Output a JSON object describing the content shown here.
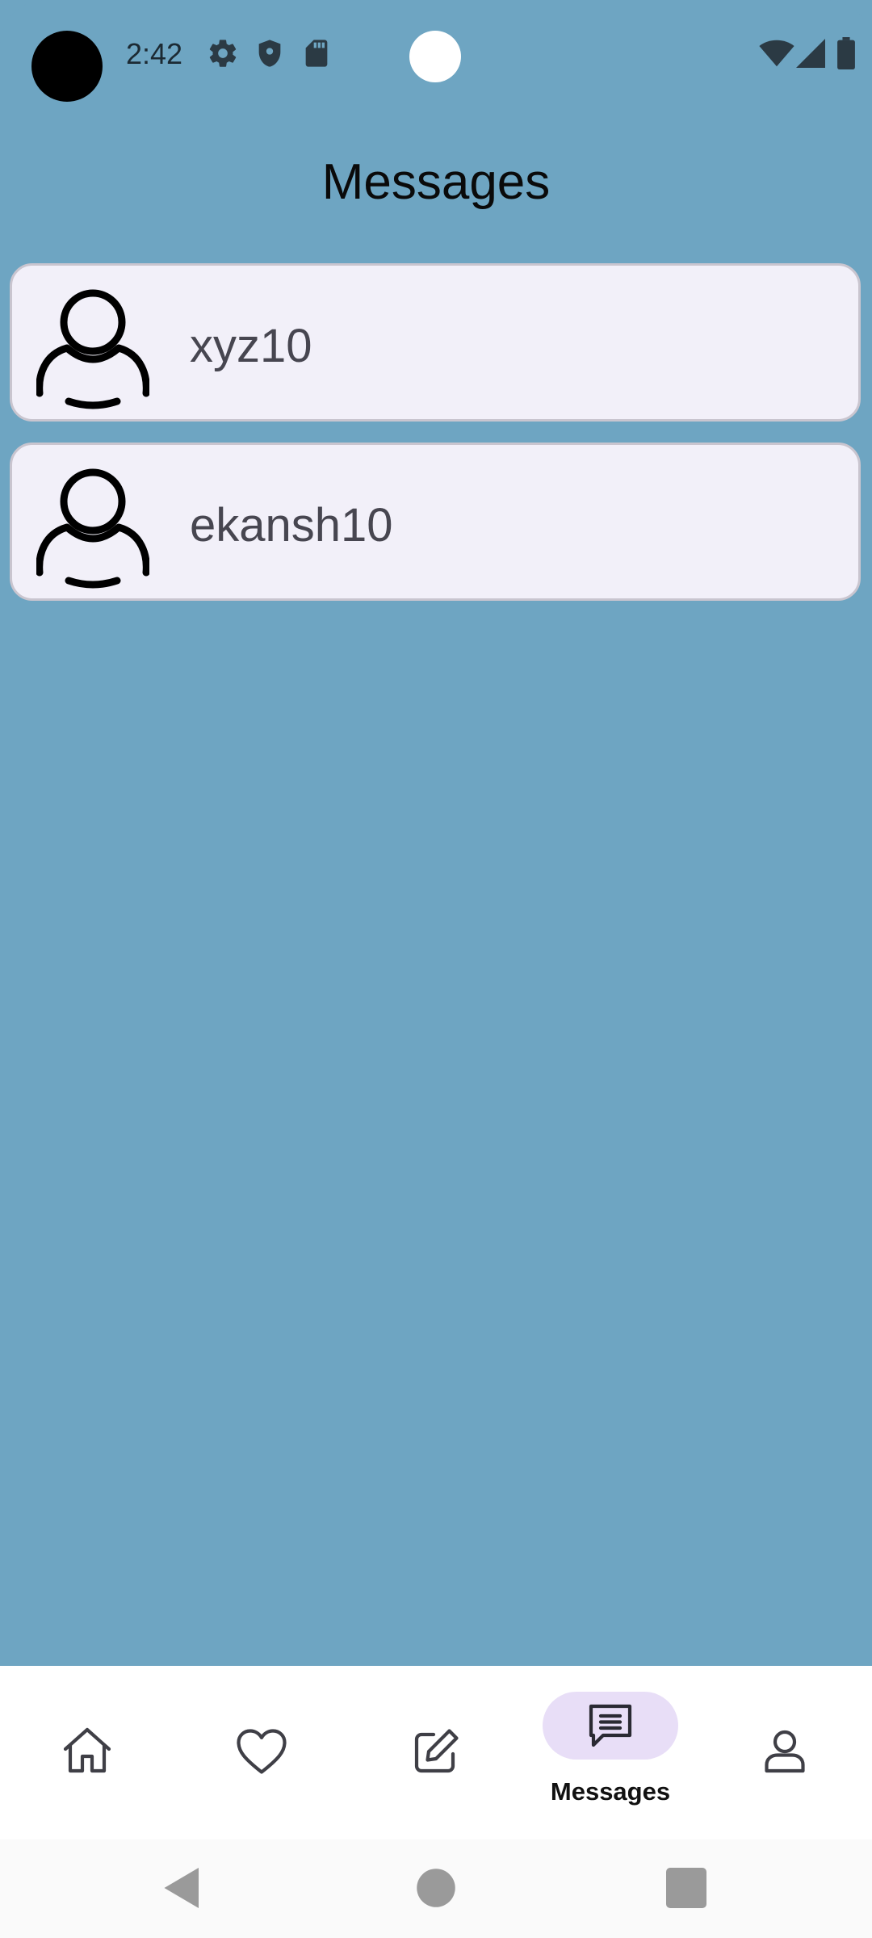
{
  "status_bar": {
    "time": "2:42",
    "icons": [
      "gear-icon",
      "shield-icon",
      "sd-card-icon",
      "wifi-icon",
      "signal-icon",
      "battery-icon"
    ]
  },
  "header": {
    "title": "Messages"
  },
  "conversations": [
    {
      "name": "xyz10",
      "avatar_icon": "person-icon"
    },
    {
      "name": "ekansh10",
      "avatar_icon": "person-icon"
    }
  ],
  "bottom_nav": {
    "items": [
      {
        "icon": "home-icon",
        "label": ""
      },
      {
        "icon": "heart-icon",
        "label": ""
      },
      {
        "icon": "edit-icon",
        "label": ""
      },
      {
        "icon": "chat-icon",
        "label": "Messages",
        "selected": true
      },
      {
        "icon": "profile-icon",
        "label": ""
      }
    ]
  },
  "system_nav": {
    "buttons": [
      "back-icon",
      "home-circle-icon",
      "recents-icon"
    ]
  },
  "colors": {
    "background": "#6ea5c2",
    "card_background": "#f2f0f9",
    "card_border": "#c9c5cf",
    "selected_pill": "#e8def7",
    "nav_background": "#ffffff"
  }
}
